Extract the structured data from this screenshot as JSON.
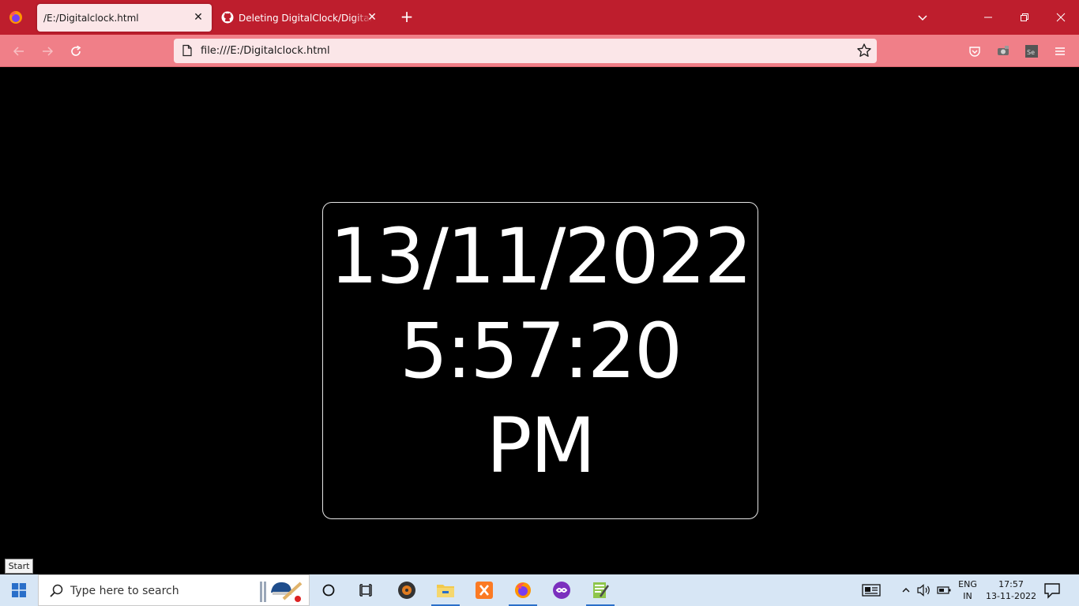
{
  "browser": {
    "tabs": [
      {
        "label": "/E:/Digitalclock.html",
        "active": true
      },
      {
        "label": "Deleting DigitalClock/Digitalclock",
        "active": false
      }
    ],
    "close_glyph": "✕",
    "newtab_glyph": "+",
    "url": "file:///E:/Digitalclock.html",
    "accent_color": "#be1e2d",
    "navbar_color": "#f07f88"
  },
  "page": {
    "date": "13/11/2022",
    "time": "5:57:20",
    "ampm": "PM"
  },
  "tooltip": {
    "text": "Start"
  },
  "taskbar": {
    "search_placeholder": "Type here to search",
    "lang_top": "ENG",
    "lang_bottom": "IN",
    "time": "17:57",
    "date": "13-11-2022"
  }
}
